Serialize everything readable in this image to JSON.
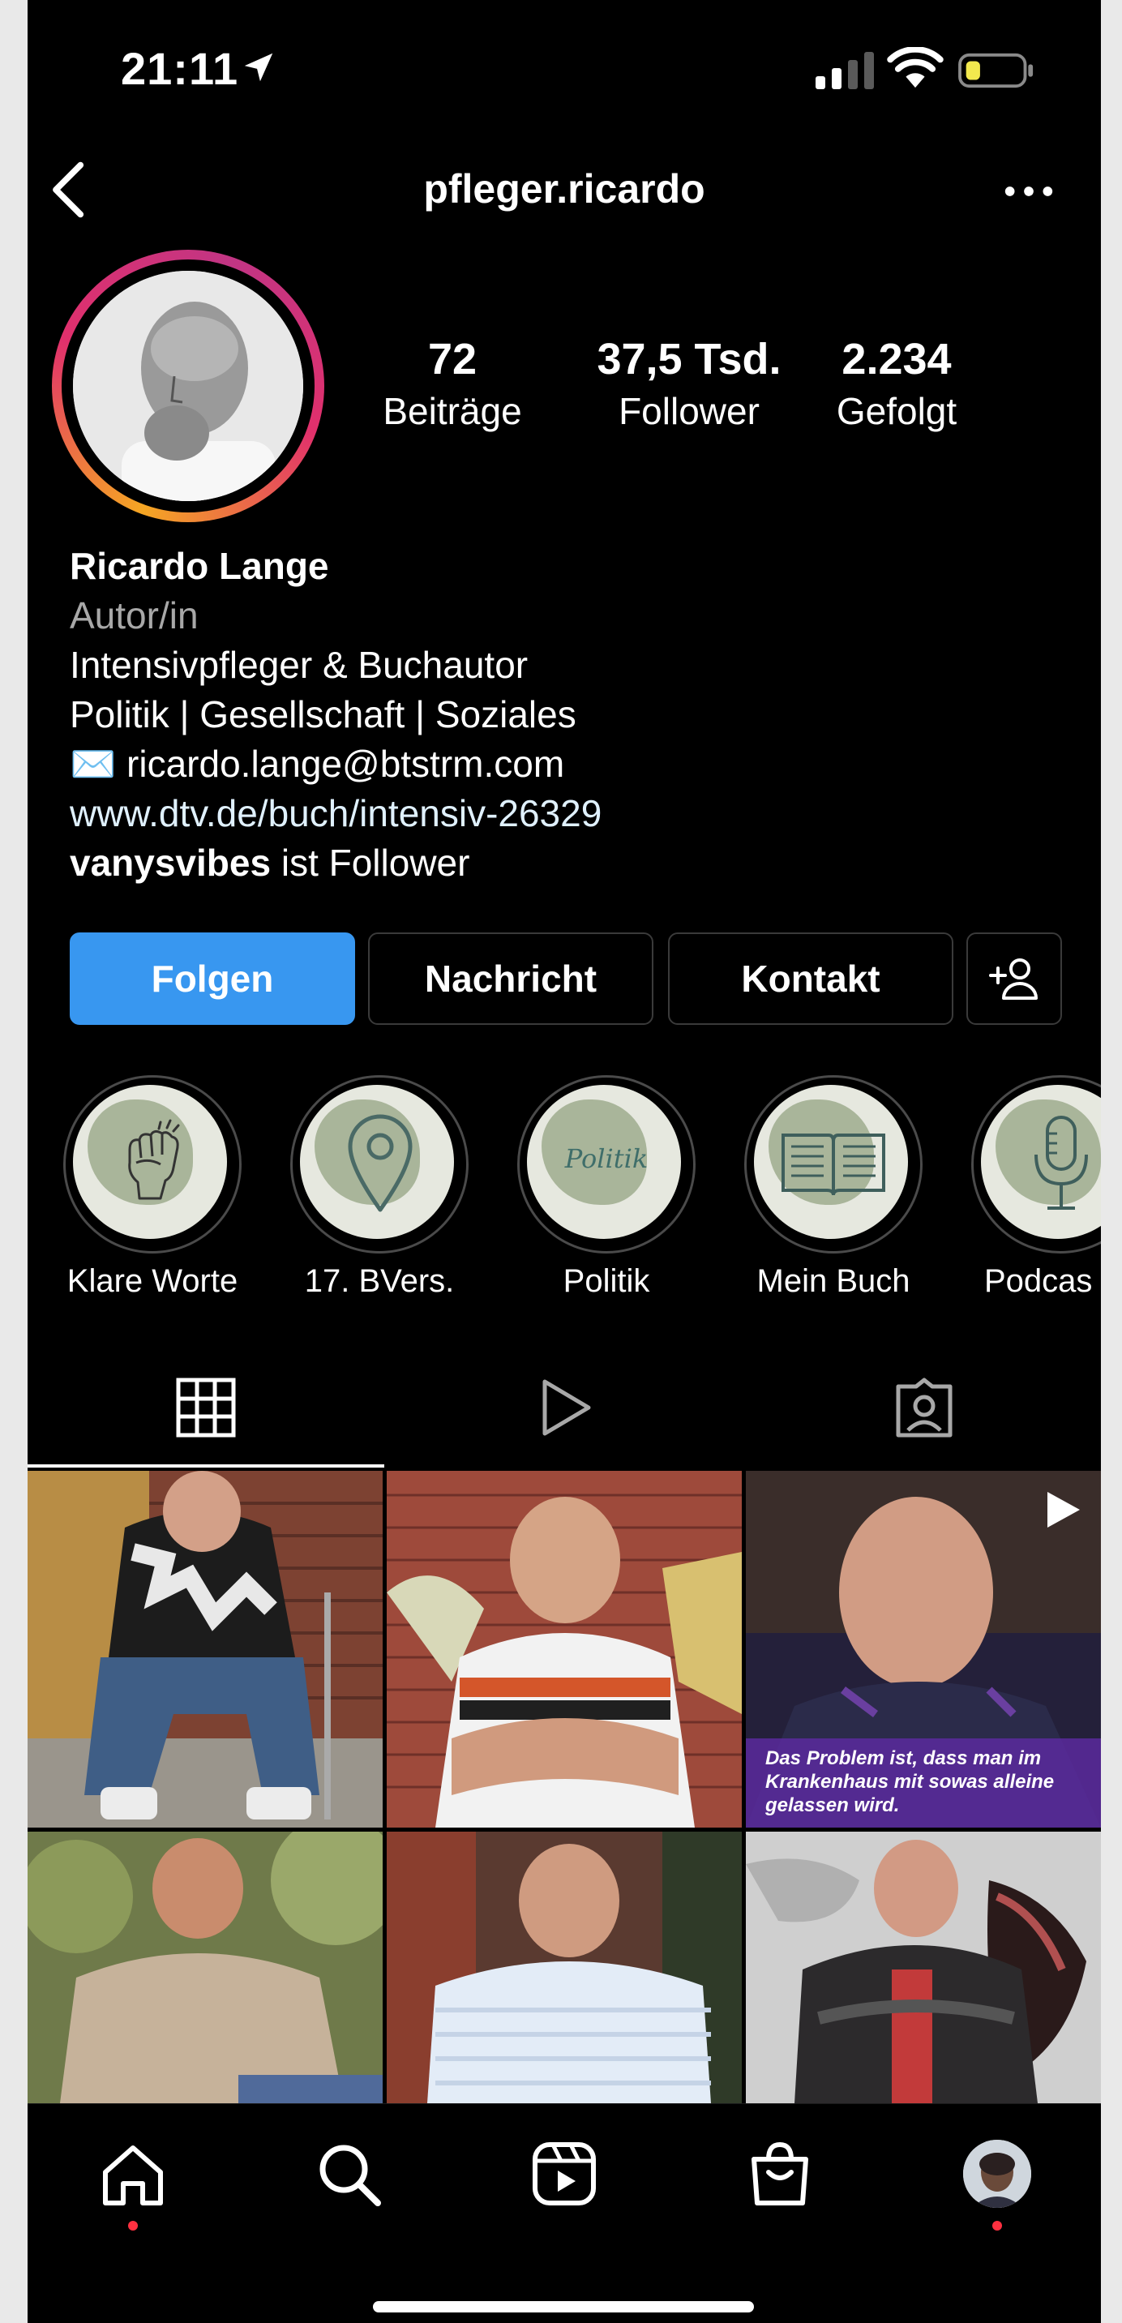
{
  "status_bar": {
    "time": "21:11",
    "icons": [
      "location-arrow-icon",
      "signal-icon",
      "wifi-icon",
      "battery-icon"
    ],
    "battery_color": "#f2e94e"
  },
  "header": {
    "username": "pfleger.ricardo",
    "icons": [
      "back-icon",
      "more-icon"
    ]
  },
  "stats": [
    {
      "value": "72",
      "label": "Beiträge"
    },
    {
      "value": "37,5 Tsd.",
      "label": "Follower"
    },
    {
      "value": "2.234",
      "label": "Gefolgt"
    }
  ],
  "bio": {
    "name": "Ricardo Lange",
    "category": "Autor/in",
    "line1": "Intensivpfleger & Buchautor",
    "line2": "Politik | Gesellschaft | Soziales",
    "email": "✉️ ricardo.lange@btstrm.com",
    "link": "www.dtv.de/buch/intensiv-26329",
    "follower_user": "vanysvibes",
    "follower_suffix": " ist Follower"
  },
  "actions": {
    "follow": "Folgen",
    "message": "Nachricht",
    "contact": "Kontakt",
    "suggest_icon": "add-person-icon",
    "primary_color": "#3897f0"
  },
  "highlights": [
    {
      "label": "Klare Worte",
      "icon": "fist-icon"
    },
    {
      "label": "17. BVers.",
      "icon": "map-pin-icon"
    },
    {
      "label": "Politik",
      "icon": "politik-text",
      "text": "Politik"
    },
    {
      "label": "Mein Buch",
      "icon": "book-icon"
    },
    {
      "label": "Podcas",
      "icon": "microphone-icon"
    }
  ],
  "tabs": [
    "grid-icon",
    "reels-icon",
    "tagged-icon"
  ],
  "posts": [
    {
      "kind": "photo"
    },
    {
      "kind": "photo"
    },
    {
      "kind": "video",
      "caption": "Das Problem ist, dass man im Krankenhaus mit sowas alleine gelassen wird."
    },
    {
      "kind": "photo"
    },
    {
      "kind": "photo"
    },
    {
      "kind": "photo"
    }
  ],
  "bottom_nav": [
    "home-icon",
    "search-icon",
    "reels-icon",
    "shop-icon",
    "profile-avatar"
  ],
  "notification_dot_color": "#ff3040"
}
